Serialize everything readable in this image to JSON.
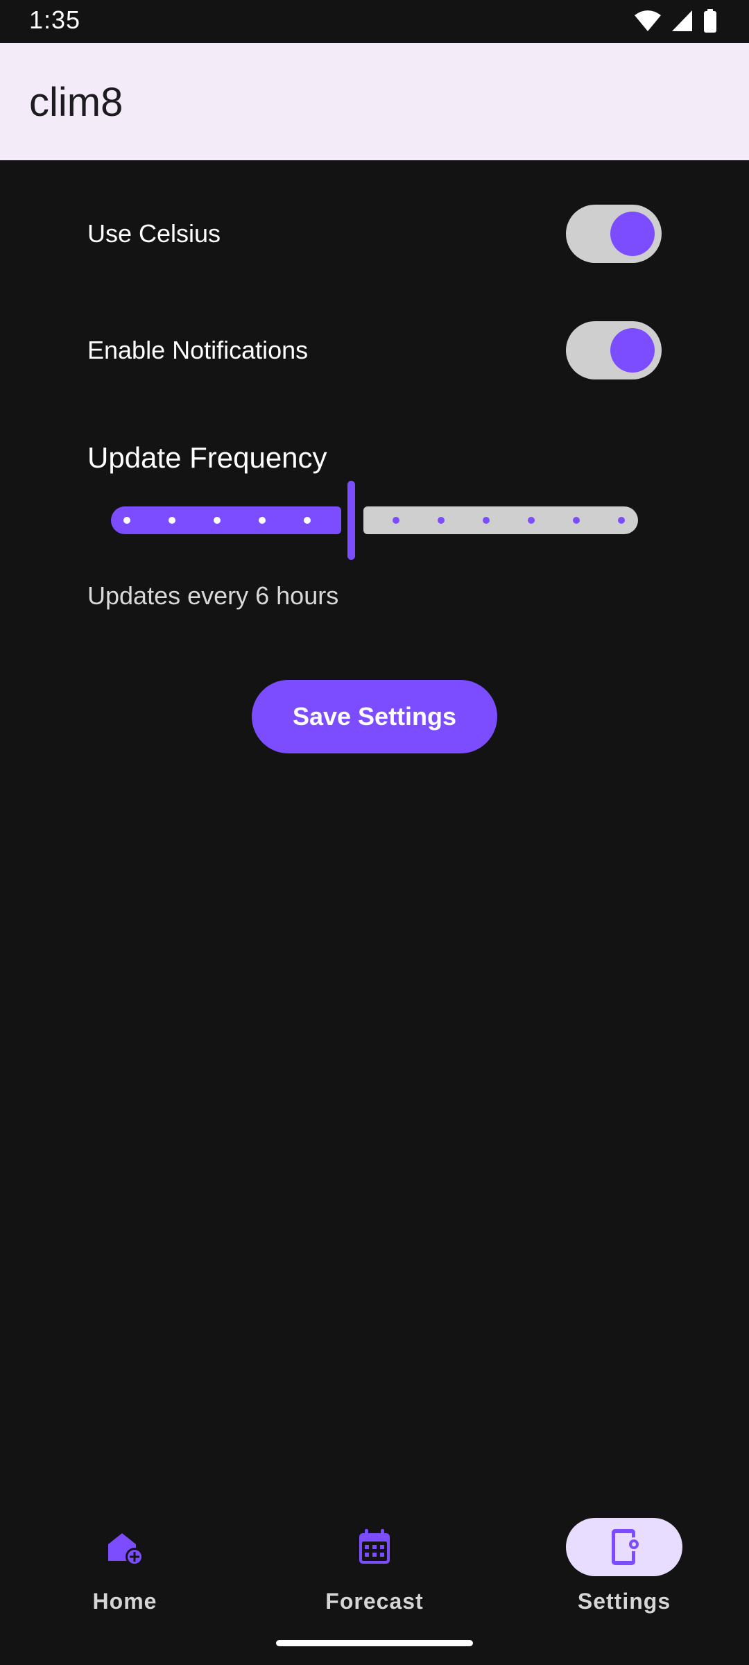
{
  "status_bar": {
    "time": "1:35",
    "icons": [
      "wifi-icon",
      "cellular-signal-icon",
      "battery-icon"
    ]
  },
  "app_bar": {
    "title": "clim8"
  },
  "settings": {
    "use_celsius": {
      "label": "Use Celsius",
      "checked": true
    },
    "enable_notifications": {
      "label": "Enable Notifications",
      "checked": true
    },
    "update_frequency": {
      "title": "Update Frequency",
      "caption": "Updates every 6 hours",
      "value_fraction": 0.45
    },
    "save_label": "Save Settings"
  },
  "nav": {
    "items": [
      {
        "label": "Home",
        "icon": "home-add-icon",
        "active": false
      },
      {
        "label": "Forecast",
        "icon": "calendar-icon",
        "active": false
      },
      {
        "label": "Settings",
        "icon": "device-settings-icon",
        "active": true
      }
    ]
  },
  "colors": {
    "accent": "#7c4dff",
    "background": "#131313",
    "app_bar": "#f3ebf8",
    "track_inactive": "#cfcfcf",
    "nav_active_pill": "#e9ddff"
  }
}
